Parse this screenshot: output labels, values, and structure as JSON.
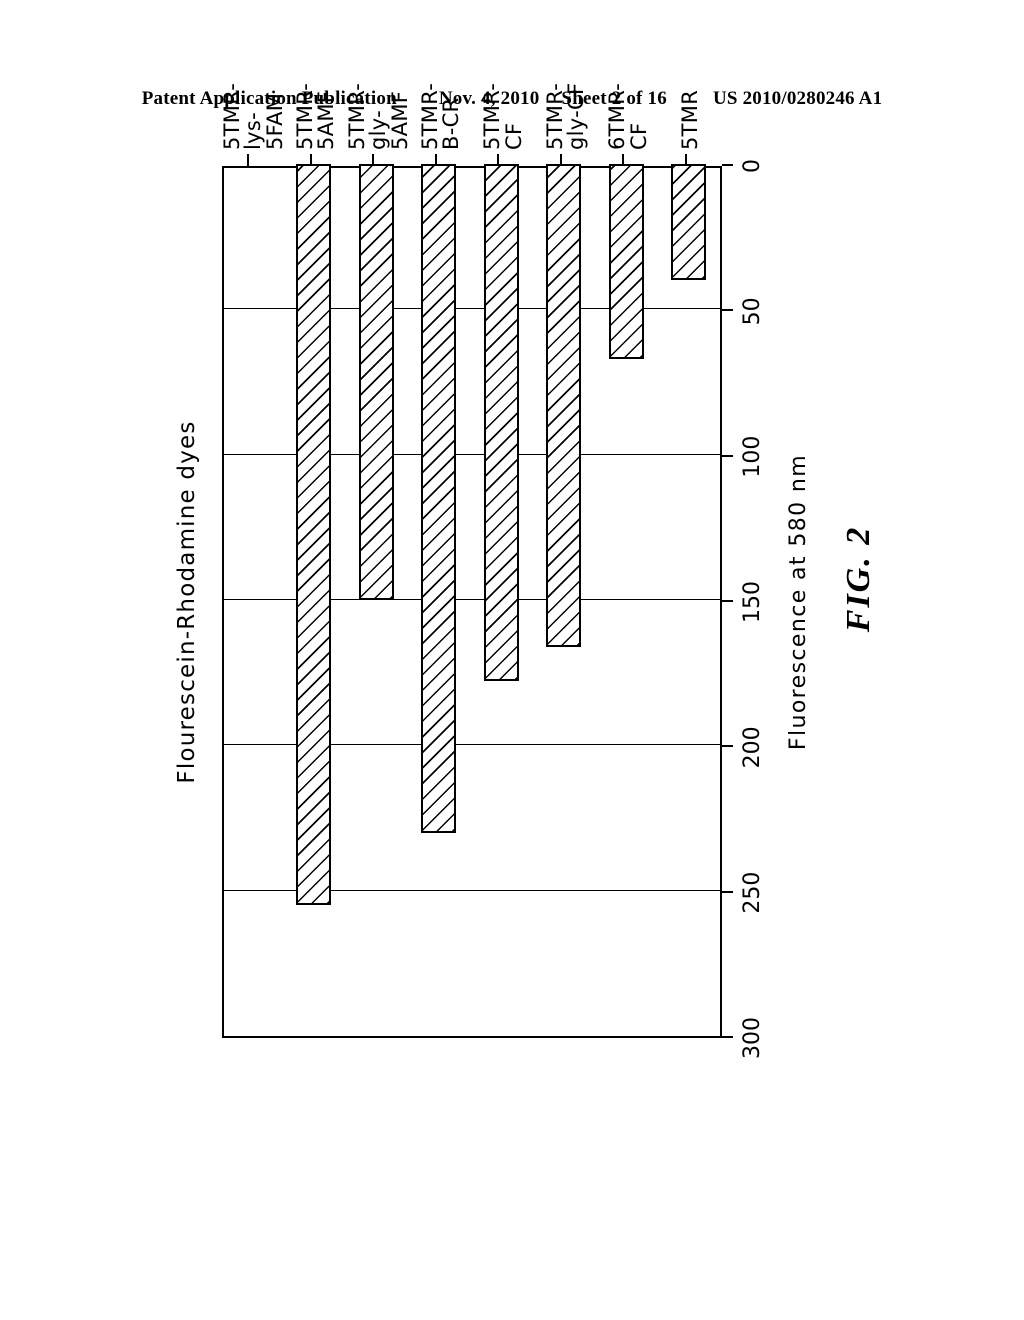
{
  "header": {
    "publication": "Patent Application Publication",
    "date": "Nov. 4, 2010",
    "sheet": "Sheet 2 of 16",
    "patent_number": "US 2010/0280246 A1"
  },
  "figure": {
    "caption": "FIG. 2"
  },
  "chart_data": {
    "type": "bar",
    "orientation": "vertical-rotated",
    "title": "Flourescein-Rhodamine dyes",
    "xlabel": "",
    "ylabel": "Fluorescence at 580 nm",
    "ylim": [
      0,
      300
    ],
    "yticks": [
      300,
      250,
      200,
      150,
      100,
      50,
      0
    ],
    "ytick_labels": [
      "300",
      "250",
      "200",
      "150",
      "100",
      "50",
      "0"
    ],
    "grid": true,
    "legend": "none",
    "categories": [
      "5TMR",
      "6TMR-\nCF",
      "5TMR-\ngly-CF",
      "5TMR-\nCF",
      "5TMR-\nB-CR",
      "5TMR-\ngly-\n5AMF",
      "5TMR-\n5AMF",
      "5TMR-\nlys-\n5FAM"
    ],
    "values": [
      40,
      67,
      166,
      178,
      230,
      150,
      255,
      0
    ],
    "bar_style": {
      "fill": "diagonal-hatch",
      "edge_color": "#000000",
      "face_color": "#ffffff"
    }
  }
}
